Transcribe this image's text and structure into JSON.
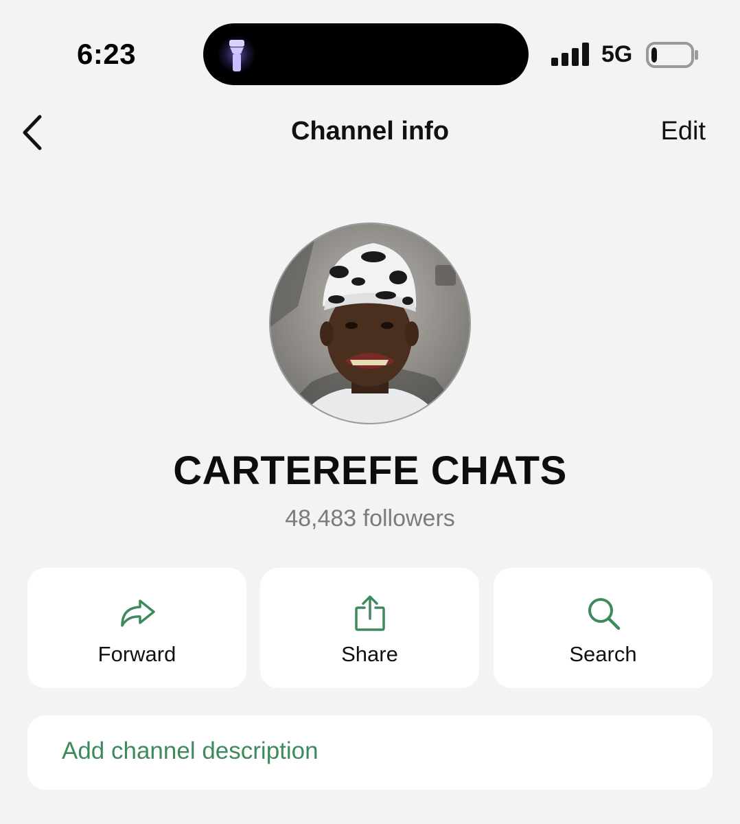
{
  "status_bar": {
    "time": "6:23",
    "network": "5G",
    "battery_level": 0.15,
    "signal_bars": 4
  },
  "nav": {
    "title": "Channel info",
    "edit_label": "Edit"
  },
  "channel": {
    "name": "CARTEREFE CHATS",
    "followers": "48,483 followers"
  },
  "actions": [
    {
      "label": "Forward",
      "icon": "forward-icon"
    },
    {
      "label": "Share",
      "icon": "share-icon"
    },
    {
      "label": "Search",
      "icon": "search-icon"
    }
  ],
  "description": {
    "placeholder": "Add channel description"
  },
  "colors": {
    "accent": "#3f8a5c",
    "background": "#f3f3f3",
    "card": "#ffffff"
  }
}
